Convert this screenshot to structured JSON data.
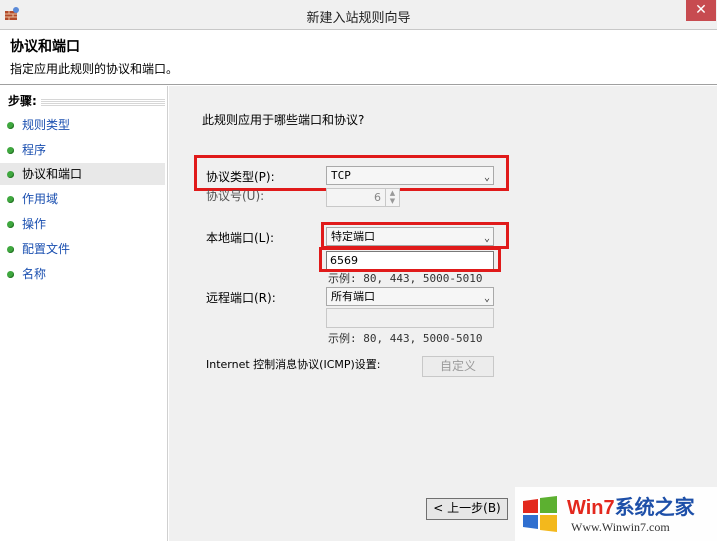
{
  "window": {
    "title": "新建入站规则向导",
    "close": "✕"
  },
  "header": {
    "title": "协议和端口",
    "subtitle": "指定应用此规则的协议和端口。"
  },
  "sidebar": {
    "steps_label": "步骤:",
    "items": [
      {
        "label": "规则类型"
      },
      {
        "label": "程序"
      },
      {
        "label": "协议和端口"
      },
      {
        "label": "作用域"
      },
      {
        "label": "操作"
      },
      {
        "label": "配置文件"
      },
      {
        "label": "名称"
      }
    ]
  },
  "main": {
    "question": "此规则应用于哪些端口和协议?",
    "protocol_type": {
      "label": "协议类型(P):",
      "value": "TCP"
    },
    "protocol_number": {
      "label": "协议号(U):",
      "value": "6"
    },
    "local_port": {
      "label": "本地端口(L):",
      "value": "特定端口",
      "input": "6569",
      "example": "示例: 80, 443, 5000-5010"
    },
    "remote_port": {
      "label": "远程端口(R):",
      "value": "所有端口",
      "input": "",
      "example": "示例: 80, 443, 5000-5010"
    },
    "icmp": {
      "label": "Internet 控制消息协议(ICMP)设置:",
      "button": "自定义"
    },
    "back_button": "< 上一步(B)"
  },
  "watermark": {
    "brand_a": "Win7",
    "brand_b": "系统之家",
    "url": "Www.Winwin7.com"
  },
  "colors": {
    "highlight": "#e01a1a",
    "link": "#1a4fb0",
    "step_dot": "#3fa83f"
  }
}
